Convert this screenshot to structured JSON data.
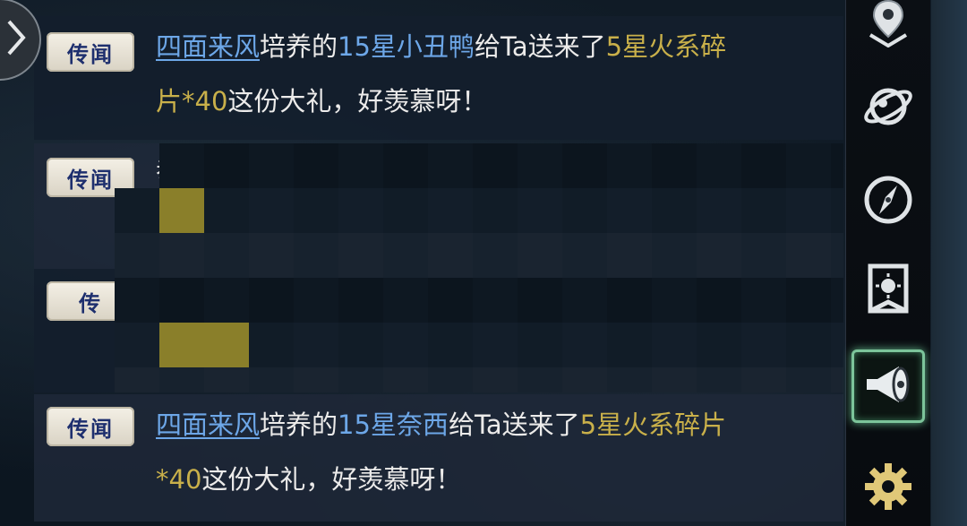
{
  "sidebar_toggle": {
    "icon": "chevron-right-icon"
  },
  "messages": [
    {
      "tag": "传闻",
      "player": "四面来风",
      "verb": "培养的",
      "pet": "15星小丑鸭",
      "middle": "给Ta送来了",
      "gift": "5星火系碎片*40",
      "end": "这份大礼，好羡慕呀！"
    },
    {
      "tag": "传闻",
      "partial_text": "恭"
    },
    {
      "tag": "传"
    },
    {
      "tag": "传闻",
      "player": "四面来风",
      "verb": "培养的",
      "pet": "15星奈西",
      "middle": "给Ta送来了",
      "gift": "5星火系碎片*40",
      "end": "这份大礼，好羡慕呀！"
    }
  ],
  "sidebar": [
    {
      "icon": "map-pin-icon"
    },
    {
      "icon": "planet-icon"
    },
    {
      "icon": "compass-icon"
    },
    {
      "icon": "banner-icon"
    },
    {
      "icon": "megaphone-icon",
      "active": true
    },
    {
      "icon": "gear-icon"
    }
  ],
  "colors": {
    "player": "#6da7e8",
    "gift": "#c9b04a",
    "active_border": "#7cc49a"
  }
}
